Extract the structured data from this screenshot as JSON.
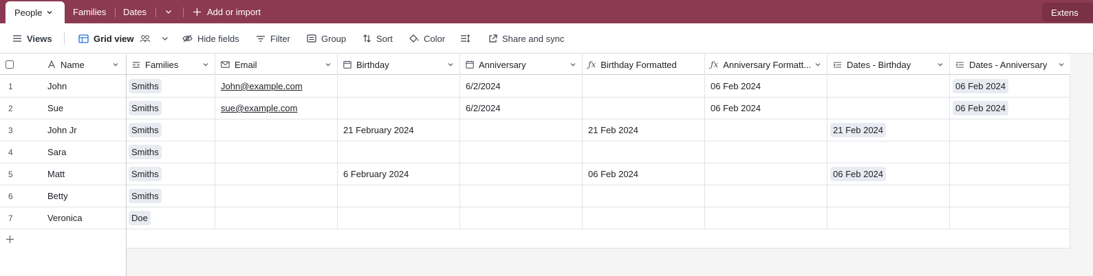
{
  "tabs": {
    "active": "People",
    "items": [
      "Families",
      "Dates"
    ],
    "add_label": "Add or import",
    "extensions_label": "Extens"
  },
  "toolbar": {
    "views": "Views",
    "grid_view": "Grid view",
    "hide_fields": "Hide fields",
    "filter": "Filter",
    "group": "Group",
    "sort": "Sort",
    "color": "Color",
    "share": "Share and sync"
  },
  "columns": {
    "name": "Name",
    "families": "Families",
    "email": "Email",
    "birthday": "Birthday",
    "anniversary": "Anniversary",
    "birthday_formatted": "Birthday Formatted",
    "anniversary_formatted": "Anniversary Formatt...",
    "dates_birthday": "Dates - Birthday",
    "dates_anniversary": "Dates - Anniversary"
  },
  "rows": [
    {
      "num": "1",
      "name": "John",
      "family": "Smiths",
      "email": "John@example.com",
      "birthday": "",
      "anniversary": "6/2/2024",
      "bday_fmt": "",
      "anniv_fmt": "06 Feb 2024",
      "dates_bday": "",
      "dates_anniv": "06 Feb 2024"
    },
    {
      "num": "2",
      "name": "Sue",
      "family": "Smiths",
      "email": "sue@example.com",
      "birthday": "",
      "anniversary": "6/2/2024",
      "bday_fmt": "",
      "anniv_fmt": "06 Feb 2024",
      "dates_bday": "",
      "dates_anniv": "06 Feb 2024"
    },
    {
      "num": "3",
      "name": "John Jr",
      "family": "Smiths",
      "email": "",
      "birthday": "21 February 2024",
      "anniversary": "",
      "bday_fmt": "21 Feb 2024",
      "anniv_fmt": "",
      "dates_bday": "21 Feb 2024",
      "dates_anniv": ""
    },
    {
      "num": "4",
      "name": "Sara",
      "family": "Smiths",
      "email": "",
      "birthday": "",
      "anniversary": "",
      "bday_fmt": "",
      "anniv_fmt": "",
      "dates_bday": "",
      "dates_anniv": ""
    },
    {
      "num": "5",
      "name": "Matt",
      "family": "Smiths",
      "email": "",
      "birthday": "6 February 2024",
      "anniversary": "",
      "bday_fmt": "06 Feb 2024",
      "anniv_fmt": "",
      "dates_bday": "06 Feb 2024",
      "dates_anniv": ""
    },
    {
      "num": "6",
      "name": "Betty",
      "family": "Smiths",
      "email": "",
      "birthday": "",
      "anniversary": "",
      "bday_fmt": "",
      "anniv_fmt": "",
      "dates_bday": "",
      "dates_anniv": ""
    },
    {
      "num": "7",
      "name": "Veronica",
      "family": "Doe",
      "email": "",
      "birthday": "",
      "anniversary": "",
      "bday_fmt": "",
      "anniv_fmt": "",
      "dates_bday": "",
      "dates_anniv": ""
    }
  ],
  "colors": {
    "tab_bar": "#8c3a52",
    "chip": "#e8ebf2"
  }
}
